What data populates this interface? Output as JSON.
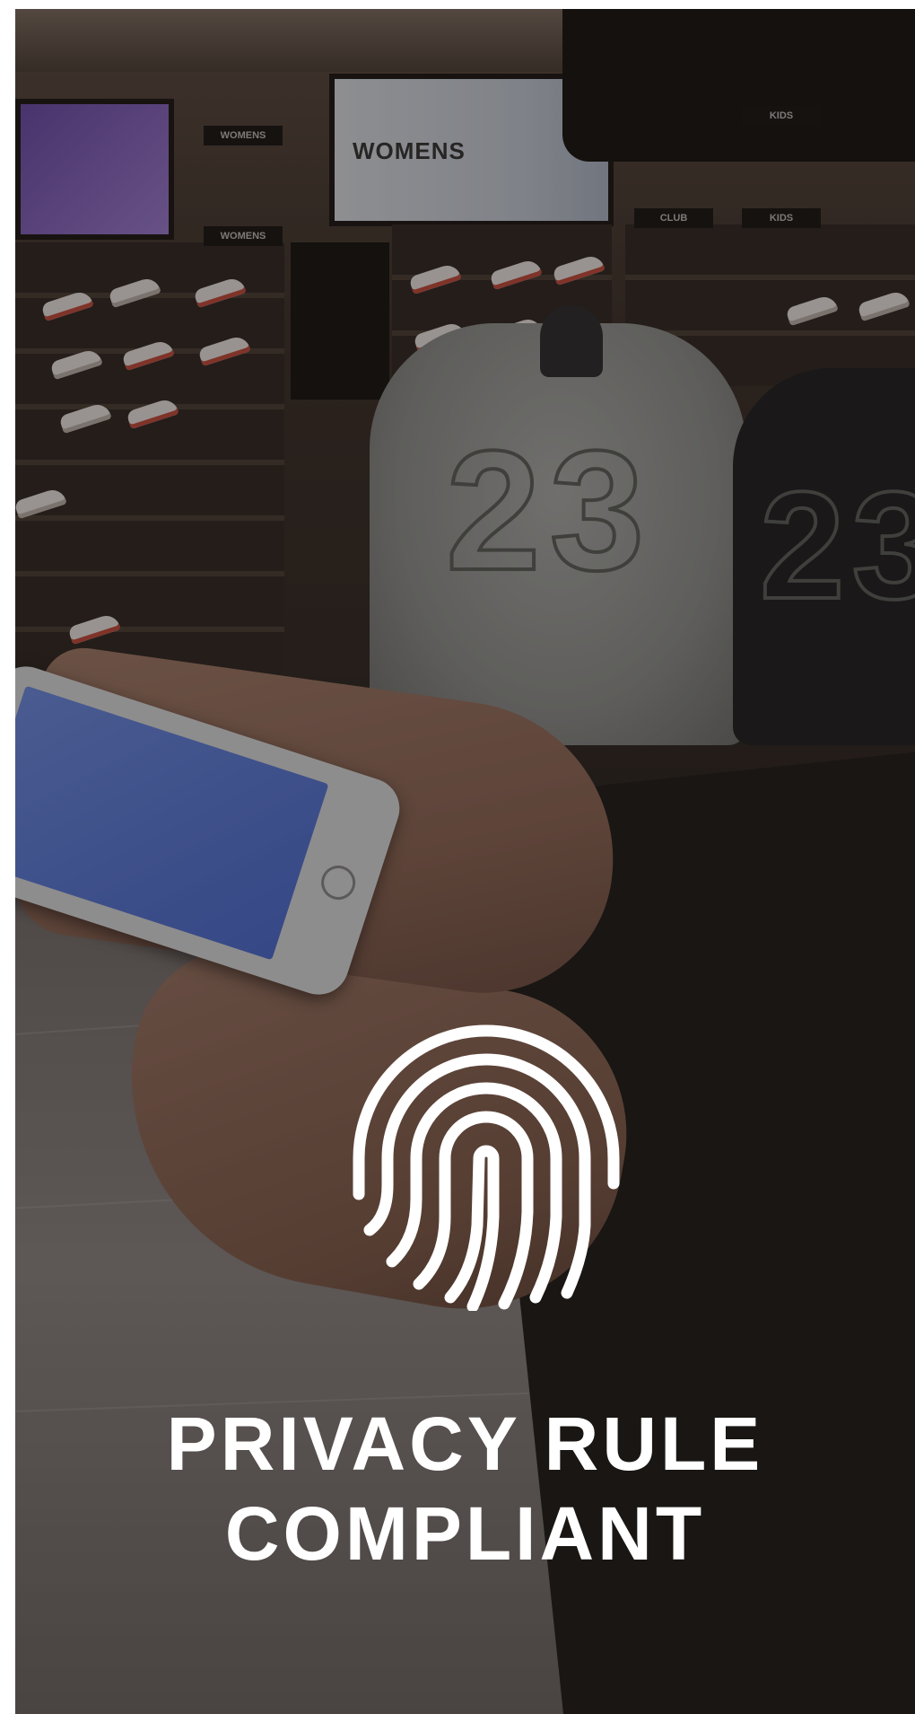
{
  "hero": {
    "headline_line1": "PRIVACY RULE",
    "headline_line2": "COMPLIANT",
    "icon": "fingerprint-icon",
    "text_color": "#ffffff"
  },
  "background": {
    "sign_womens": "WOMENS",
    "shelf_signs": [
      "WOMENS",
      "WOMENS",
      "KIDS",
      "KIDS",
      "CLUB"
    ],
    "jersey_number": "23"
  }
}
